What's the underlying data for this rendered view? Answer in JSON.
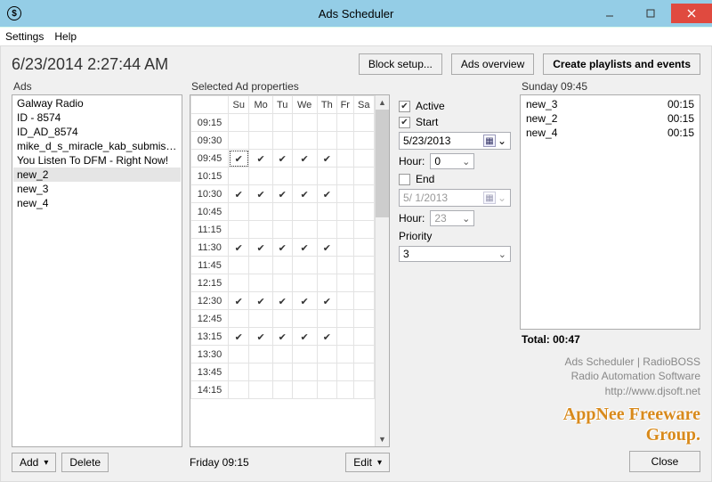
{
  "window": {
    "title": "Ads Scheduler"
  },
  "menu": {
    "settings": "Settings",
    "help": "Help"
  },
  "clock": "6/23/2014 2:27:44 AM",
  "buttons": {
    "block_setup": "Block setup...",
    "ads_overview": "Ads overview",
    "create_playlists": "Create playlists and events",
    "add": "Add",
    "delete": "Delete",
    "edit": "Edit",
    "close": "Close"
  },
  "ads": {
    "label": "Ads",
    "items": [
      "Galway Radio",
      "ID - 8574",
      "ID_AD_8574",
      "mike_d_s_miracle_kab_submiss...",
      "You Listen To DFM - Right Now!",
      "new_2",
      "new_3",
      "new_4"
    ],
    "selected_index": 5
  },
  "schedule": {
    "label": "Selected Ad properties",
    "days": [
      "Su",
      "Mo",
      "Tu",
      "We",
      "Th",
      "Fr",
      "Sa"
    ],
    "times": [
      "09:15",
      "09:30",
      "09:45",
      "10:15",
      "10:30",
      "10:45",
      "11:15",
      "11:30",
      "11:45",
      "12:15",
      "12:30",
      "12:45",
      "13:15",
      "13:30",
      "13:45",
      "14:15"
    ],
    "checked_rows": [
      "09:45",
      "10:30",
      "11:30",
      "12:30",
      "13:15"
    ],
    "checked_days": [
      "Su",
      "Mo",
      "Tu",
      "We",
      "Th"
    ],
    "focus": {
      "time": "09:45",
      "day": "Su"
    },
    "footer": "Friday 09:15"
  },
  "props": {
    "active_label": "Active",
    "active_checked": true,
    "start_label": "Start",
    "start_checked": true,
    "start_date": "5/23/2013",
    "hour_label": "Hour:",
    "start_hour": "0",
    "end_label": "End",
    "end_checked": false,
    "end_date": "5/ 1/2013",
    "end_hour": "23",
    "priority_label": "Priority",
    "priority": "3"
  },
  "playlist": {
    "label": "Sunday 09:45",
    "items": [
      {
        "name": "new_3",
        "dur": "00:15"
      },
      {
        "name": "new_2",
        "dur": "00:15"
      },
      {
        "name": "new_4",
        "dur": "00:15"
      }
    ],
    "total_label": "Total: 00:47"
  },
  "credit": {
    "l1": "Ads Scheduler | RadioBOSS",
    "l2": "Radio Automation Software",
    "l3": "http://www.djsoft.net"
  },
  "watermark": "AppNee Freeware Group."
}
